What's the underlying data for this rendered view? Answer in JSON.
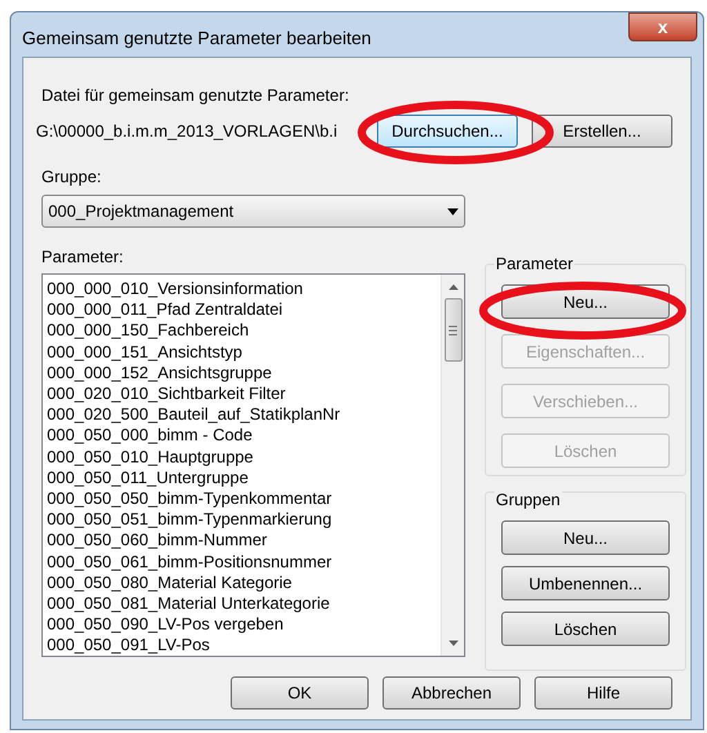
{
  "window": {
    "title": "Gemeinsam genutzte Parameter bearbeiten",
    "close": "x"
  },
  "file": {
    "label": "Datei für gemeinsam genutzte Parameter:",
    "value": "G:\\00000_b.i.m.m_2013_VORLAGEN\\b.i",
    "buttons": [
      {
        "label": "Durchsuchen...",
        "focused": true
      },
      {
        "label": "Erstellen...",
        "focused": false
      }
    ]
  },
  "group": {
    "label": "Gruppe:",
    "value": "000_Projektmanagement"
  },
  "parameters": {
    "label": "Parameter:",
    "items": [
      "000_000_010_Versionsinformation",
      "000_000_011_Pfad Zentraldatei",
      "000_000_150_Fachbereich",
      "000_000_151_Ansichtstyp",
      "000_000_152_Ansichtsgruppe",
      "000_020_010_Sichtbarkeit Filter",
      "000_020_500_Bauteil_auf_StatikplanNr",
      "000_050_000_bimm - Code",
      "000_050_010_Hauptgruppe",
      "000_050_011_Untergruppe",
      "000_050_050_bimm-Typenkommentar",
      "000_050_051_bimm-Typenmarkierung",
      "000_050_060_bimm-Nummer",
      "000_050_061_bimm-Positionsnummer",
      "000_050_080_Material Kategorie",
      "000_050_081_Material Unterkategorie",
      "000_050_090_LV-Pos vergeben",
      "000_050_091_LV-Pos"
    ]
  },
  "parameter_box": {
    "label": "Parameter",
    "buttons": [
      {
        "label": "Neu...",
        "disabled": false
      },
      {
        "label": "Eigenschaften...",
        "disabled": true
      },
      {
        "label": "Verschieben...",
        "disabled": true
      },
      {
        "label": "Löschen",
        "disabled": true
      }
    ]
  },
  "groups_box": {
    "label": "Gruppen",
    "buttons": [
      {
        "label": "Neu...",
        "disabled": false
      },
      {
        "label": "Umbenennen...",
        "disabled": false
      },
      {
        "label": "Löschen",
        "disabled": false
      }
    ]
  },
  "footer_buttons": [
    "OK",
    "Abbrechen",
    "Hilfe"
  ]
}
